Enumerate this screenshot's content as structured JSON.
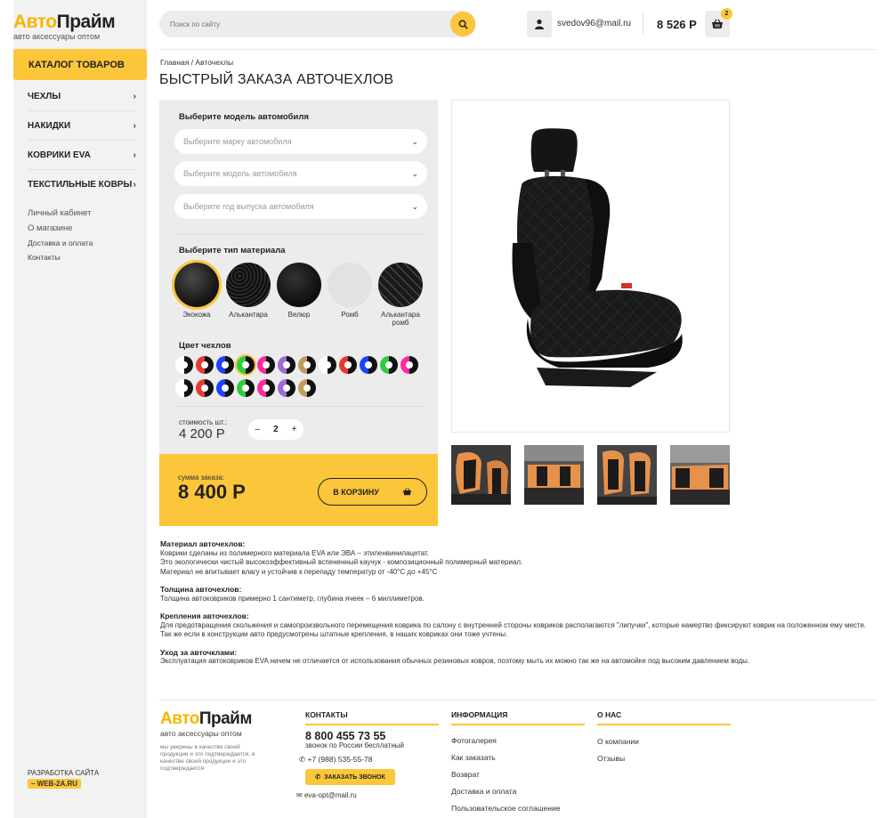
{
  "logo": {
    "part1": "Авто",
    "part2": "Прайм",
    "subtitle": "авто аксессуары оптом"
  },
  "sidebar": {
    "catalog_button": "КАТАЛОГ ТОВАРОВ",
    "menu": [
      {
        "label": "ЧЕХЛЫ"
      },
      {
        "label": "НАКИДКИ"
      },
      {
        "label": "КОВРИКИ EVA"
      },
      {
        "label": "ТЕКСТИЛЬНЫЕ КОВРЫ"
      }
    ],
    "links": [
      "Личный кабинет",
      "О магазине",
      "Доставка и оплата",
      "Контакты"
    ],
    "dev_label": "РАЗРАБОТКА САЙТА",
    "dev_badge": "– WEB-2A.RU"
  },
  "header": {
    "search_placeholder": "Поиск по сайту",
    "email": "svedov96@mail.ru",
    "balance": "8 526 Р",
    "cart_count": "2"
  },
  "breadcrumb": "Главная / Авточехлы",
  "title": "БЫСТРЫЙ ЗАКАЗА АВТОЧЕХЛОВ",
  "form": {
    "model_label": "Выберите модель автомобиля",
    "selects": [
      "Выберите марку автомобиля",
      "Выберите модель автомобиля",
      "Выберите год выпуска автомобиля"
    ],
    "material_label": "Выберите тип материала",
    "materials": [
      {
        "label": "Экокожа",
        "color": "#2a2a2a"
      },
      {
        "label": "Алькантара",
        "color": "#1a1a1a"
      },
      {
        "label": "Велюр",
        "color": "#222222"
      },
      {
        "label": "Ромб",
        "color": "#e2e2e2"
      },
      {
        "label": "Алькантара ромб",
        "color": "#1c1c1c"
      }
    ],
    "color_label": "Цвет чехлов",
    "colors_row1": [
      "#ffffff",
      "#e53935",
      "#1e40ff",
      "#2ecc40",
      "#ff2aa0",
      "#9c6bd3",
      "#c49a5a",
      "#ffffff",
      "#e53935",
      "#1e40ff",
      "#2ecc40",
      "#ff2aa0"
    ],
    "colors_row2": [
      "#ffffff",
      "#e53935",
      "#1e40ff",
      "#2ecc40",
      "#ff2aa0",
      "#9c6bd3",
      "#c49a5a"
    ],
    "price_label": "стоимость шт.:",
    "price": "4 200 Р",
    "qty_minus": "–",
    "qty": "2",
    "qty_plus": "+",
    "sum_label": "сумма заказа:",
    "sum": "8 400 Р",
    "cart_button": "В КОРЗИНУ"
  },
  "description": [
    {
      "title": "Материал авточехлов:",
      "text": [
        "Коврики сделаны из полимерного материала EVA или ЭВА – этиленвинилацетат.",
        "Это экологически чистый высокоэффективный вспененный каучук - композиционный полимерный материал.",
        "Материал не впитывает влагу и устойчив к перепаду температур от -40°С до +45°С"
      ]
    },
    {
      "title": "Толщина авточехлов:",
      "text": [
        "Толщина автоковриков примерно 1 сантиметр, глубина ячеек – 6 миллиметров."
      ]
    },
    {
      "title": "Крепления авточехлов:",
      "text": [
        "Для предотвращения скольжения и самопроизвольного перемещения коврика по салону с внутренней стороны ковриков располагаются \"липучки\", которые намертво фиксируют коврик на положенном ему месте. Так же если в конструкции авто предусмотрены штатные крепления, в наших ковриках они тоже учтены."
      ]
    },
    {
      "title": "Уход за авточклами:",
      "text": [
        "Эксплуатация автоковриков EVA ничем не отличается от использования обычных резиновых ковров, поэтому мыть их можно так же на автомойке под высоким давлением воды."
      ]
    }
  ],
  "footer": {
    "note": "мы уверены в качестве своей продукции и это подтверждается, в качестве своей продукции и это подтверждается",
    "contacts_title": "КОНТАКТЫ",
    "phone": "8 800 455 73 55",
    "phone_note": "звонок по России бесплатный",
    "phone2": "+7 (988) 535-55-78",
    "call_button": "ЗАКАЗАТЬ ЗВОНОК",
    "email": "eva-opt@mail.ru",
    "info_title": "ИНФОРМАЦИЯ",
    "info_items": [
      "Фотогалерея",
      "Как заказать",
      "Возврат",
      "Доставка и оплата",
      "Пользовательское соглашение"
    ],
    "about_title": "О НАС",
    "about_items": [
      "О компании",
      "Отзывы"
    ]
  }
}
